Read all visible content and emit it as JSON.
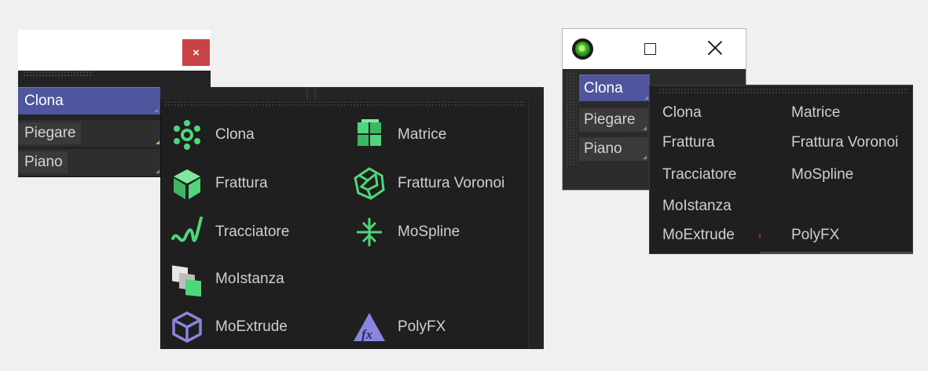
{
  "left_panel": {
    "close_label": "×",
    "items": [
      {
        "label": "Clona"
      },
      {
        "label": "Piegare"
      },
      {
        "label": "Piano"
      }
    ],
    "popup": {
      "items": [
        {
          "label": "Clona",
          "icon": "cloner-icon"
        },
        {
          "label": "Matrice",
          "icon": "matrix-icon"
        },
        {
          "label": "Frattura",
          "icon": "fracture-icon"
        },
        {
          "label": "Frattura Voronoi",
          "icon": "voronoi-fracture-icon"
        },
        {
          "label": "Tracciatore",
          "icon": "tracer-icon"
        },
        {
          "label": "MoSpline",
          "icon": "mospline-icon"
        },
        {
          "label": "MoIstanza",
          "icon": "moinstance-icon"
        },
        {
          "label": "MoExtrude",
          "icon": "moextrude-icon"
        },
        {
          "label": "PolyFX",
          "icon": "polyfx-icon"
        }
      ]
    }
  },
  "right_panel": {
    "items": [
      {
        "label": "Clona"
      },
      {
        "label": "Piegare"
      },
      {
        "label": "Piano"
      }
    ],
    "popup": {
      "items": [
        {
          "label": "Clona"
        },
        {
          "label": "Matrice"
        },
        {
          "label": "Frattura"
        },
        {
          "label": "Frattura Voronoi"
        },
        {
          "label": "Tracciatore"
        },
        {
          "label": "MoSpline"
        },
        {
          "label": "MoIstanza"
        },
        {
          "label": "MoExtrude"
        },
        {
          "label": "PolyFX"
        }
      ]
    }
  },
  "colors": {
    "selected_bg": "#4f569e",
    "close_button": "#c94245",
    "icon_green": "#4fd67a",
    "icon_purple": "#8a86e0",
    "panel_dark": "#1f1f1f"
  }
}
